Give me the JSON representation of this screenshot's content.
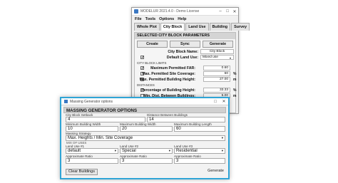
{
  "back_window": {
    "title": "MODELUR 2021.4.0 - Demo License",
    "menu": [
      "File",
      "Tools",
      "Options",
      "Help"
    ],
    "tabs": [
      "Whole Plot",
      "City Block",
      "Land Use",
      "Building",
      "Survey"
    ],
    "active_tab": "City Block",
    "section_title": "SELECTED CITY BLOCK PARAMETERS",
    "buttons": [
      "Create",
      "Sync",
      "Generate"
    ],
    "city_block_name_label": "City Block Name:",
    "city_block_name_value": "City Block",
    "default_land_use_label": "Default Land Use:",
    "default_land_use_value": "Mixed use",
    "limits_header": "CITY BLOCK LIMITS",
    "max_far_label": "Maximum Permitted FAR:",
    "max_far_value": "0.60",
    "max_site_coverage_label": "Max. Permitted Site Coverage:",
    "max_site_coverage_value": "60",
    "max_site_coverage_unit": "%",
    "max_building_height_label": "Max. Permitted Building Height:",
    "max_building_height_value": "27.00",
    "max_building_height_unit": "m",
    "distances_header": "DISTANCES",
    "pct_building_height_label": "Percentage of Building Height:",
    "pct_building_height_value": "33.33",
    "pct_building_height_unit": "%",
    "min_dist_buildings_label": "Min. Dist. Between Buildings:",
    "min_dist_buildings_value": "5.00",
    "min_dist_buildings_unit": "m"
  },
  "front_window": {
    "title": "Massing Generator options",
    "section_title": "MASSING GENERATOR OPTIONS",
    "city_block_setback_label": "City Block Setback",
    "city_block_setback_value": "4",
    "distance_between_buildings_label": "Distance Between Buildings",
    "distance_between_buildings_value": "14",
    "min_building_width_label": "Minimum Building Width",
    "min_building_width_value": "10",
    "max_building_width_label": "Maximum Building Width",
    "max_building_width_value": "20",
    "max_building_length_label": "Maximum Building Length",
    "max_building_length_value": "60",
    "massing_strategy_label": "Massing Strategy",
    "massing_strategy_value": "Max. Heights / Min. Site Coverage",
    "mix_of_uses_label": "MIX OF USES",
    "land_use_1_label": "Land Use #1",
    "land_use_1_value": "default",
    "land_use_2_label": "Land Use #2",
    "land_use_2_value": "Special",
    "land_use_3_label": "Land Use #3",
    "land_use_3_value": "Residential",
    "approx_ratio_1_label": "Approximate Ratio",
    "approx_ratio_1_value": "3",
    "approx_ratio_2_label": "Approximate Ratio",
    "approx_ratio_2_value": "3",
    "approx_ratio_3_label": "Approximate Ratio",
    "approx_ratio_3_value": "3",
    "clear_buildings_label": "Clear Buildings",
    "generate_label": "Generate",
    "accent_color": "#2fa4d6"
  }
}
